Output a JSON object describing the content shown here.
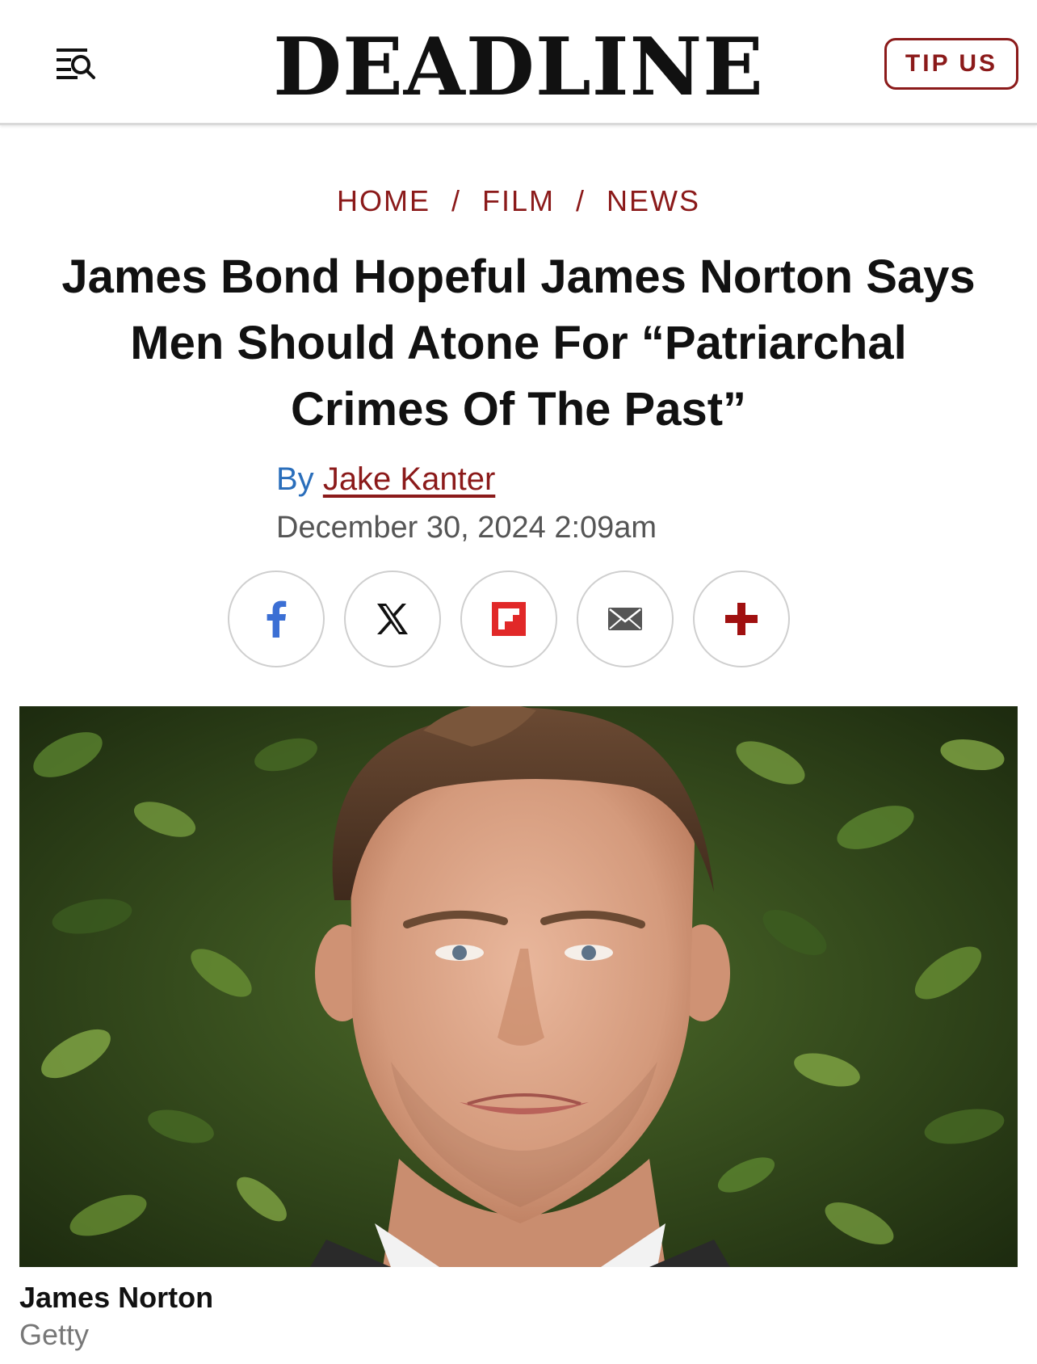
{
  "header": {
    "logo": "DEADLINE",
    "menu_icon": "menu-search-icon",
    "tip_button": "TIP US",
    "accent_color": "#8b1a1a"
  },
  "breadcrumb": {
    "items": [
      "HOME",
      "FILM",
      "NEWS"
    ],
    "separator": "/"
  },
  "article": {
    "headline_lines": [
      "James Bond Hopeful James Norton Says",
      "Men Should Atone For “Patriarchal",
      "Crimes Of The Past”"
    ],
    "by_label": "By",
    "author": "Jake Kanter",
    "date": "December 30, 2024 2:09am"
  },
  "share": {
    "buttons": [
      {
        "icon": "facebook-icon",
        "color": "#3b6fd4"
      },
      {
        "icon": "x-icon",
        "color": "#111111"
      },
      {
        "icon": "flipboard-icon",
        "color": "#e12828"
      },
      {
        "icon": "email-icon",
        "color": "#555555"
      },
      {
        "icon": "plus-icon",
        "color": "#a01010"
      }
    ]
  },
  "photo": {
    "caption": "James Norton",
    "credit": "Getty"
  }
}
